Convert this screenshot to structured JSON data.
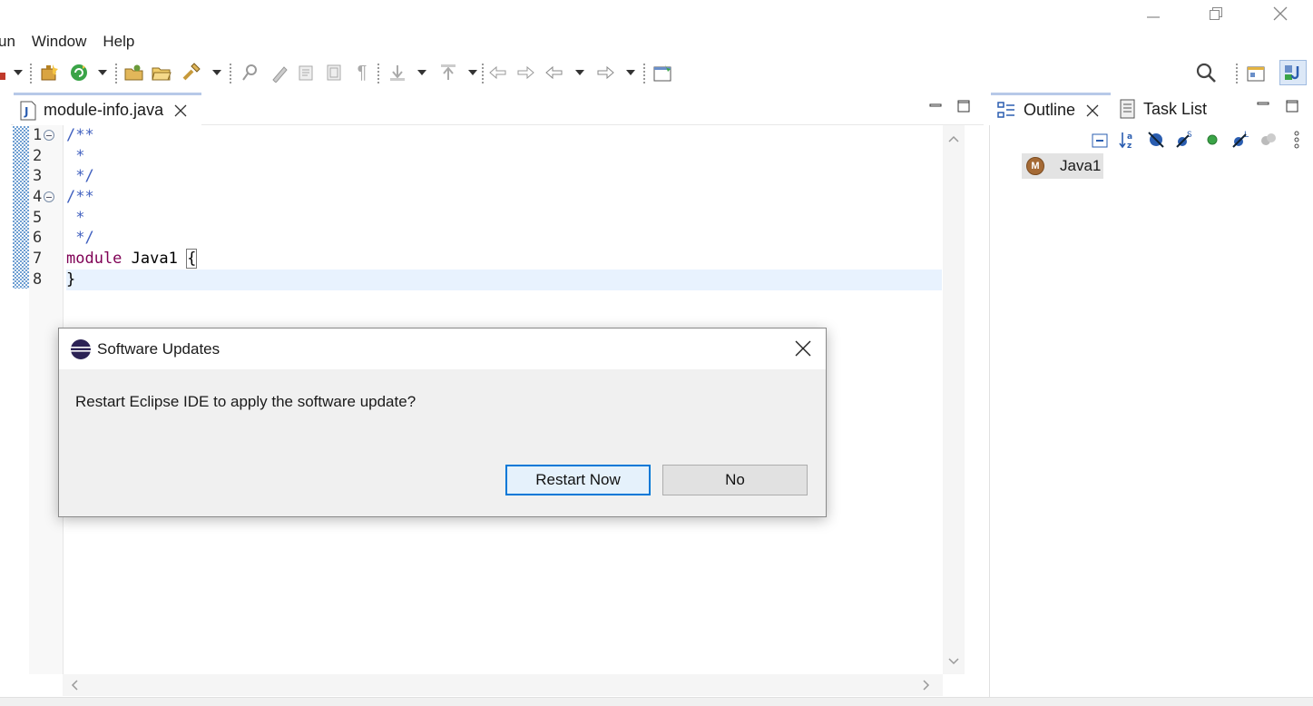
{
  "window": {
    "controls": [
      "minimize",
      "restore",
      "close"
    ]
  },
  "menu": {
    "items": [
      "un",
      "Window",
      "Help"
    ]
  },
  "toolbar": {
    "icons": [
      "new-package-icon",
      "run-icon",
      "open-type-icon",
      "open-folder-icon",
      "build-icon",
      "annotation-icon",
      "pen-icon",
      "format-icon",
      "block-icon",
      "show-whitespace-icon",
      "next-annotation-icon",
      "previous-annotation-icon",
      "back-edit-icon",
      "forward-edit-icon",
      "back-icon",
      "forward-icon",
      "open-perspective-icon"
    ],
    "search_icon": "search-icon"
  },
  "editor": {
    "tab_label": "module-info.java",
    "line_numbers": [
      "1",
      "2",
      "3",
      "4",
      "5",
      "6",
      "7",
      "8"
    ],
    "lines": [
      {
        "text": "/**"
      },
      {
        "text": " *"
      },
      {
        "text": " */"
      },
      {
        "text": "/**"
      },
      {
        "text": " *"
      },
      {
        "text": " */"
      },
      {
        "keyword": "module",
        "name": " Java1 ",
        "brace": "{"
      },
      {
        "text": "}"
      }
    ]
  },
  "outline_panel": {
    "tabs": [
      "Outline",
      "Task List"
    ],
    "item_label": "Java1",
    "item_badge": "M"
  },
  "dialog": {
    "title": "Software Updates",
    "message": "Restart Eclipse IDE to apply the software update?",
    "primary_button": "Restart Now",
    "secondary_button": "No"
  },
  "colors": {
    "comment": "#3f5fbf",
    "keyword": "#7f0055",
    "accent": "#0078d7",
    "current_line": "#e8f2fe"
  }
}
